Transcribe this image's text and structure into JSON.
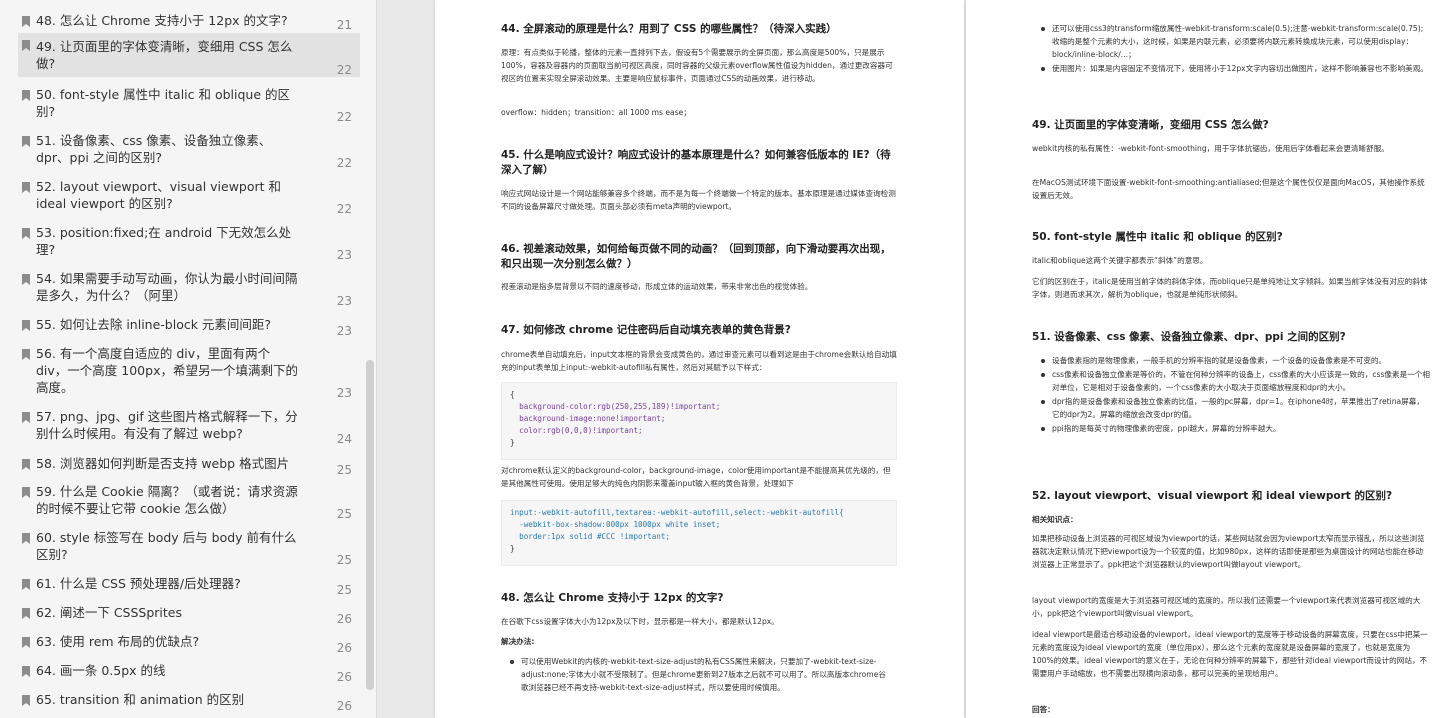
{
  "toc": [
    {
      "title": "48. 怎么让 Chrome 支持小于 12px 的文字?",
      "page": "21"
    },
    {
      "title": "49. 让页面里的字体变清晰，变细用 CSS 怎么做?",
      "page": "22"
    },
    {
      "title": "50. font-style 属性中 italic 和 oblique 的区别?",
      "page": "22"
    },
    {
      "title": "51. 设备像素、css 像素、设备独立像素、dpr、ppi 之间的区别?",
      "page": "22"
    },
    {
      "title": "52. layout viewport、visual viewport 和 ideal viewport 的区别?",
      "page": "22"
    },
    {
      "title": "53. position:fixed;在 android 下无效怎么处理?",
      "page": "23"
    },
    {
      "title": "54. 如果需要手动写动画，你认为最小时间间隔是多久，为什么？（阿里）",
      "page": "23"
    },
    {
      "title": "55. 如何让去除 inline-block 元素间间距?",
      "page": "23"
    },
    {
      "title": "56. 有一个高度自适应的 div，里面有两个 div，一个高度 100px，希望另一个填满剩下的高度。",
      "page": "23"
    },
    {
      "title": "57. png、jpg、gif 这些图片格式解释一下，分别什么时候用。有没有了解过 webp?",
      "page": "24"
    },
    {
      "title": "58. 浏览器如何判断是否支持 webp 格式图片",
      "page": "25"
    },
    {
      "title": "59. 什么是 Cookie 隔离？（或者说：请求资源的时候不要让它带 cookie 怎么做）",
      "page": "25"
    },
    {
      "title": "60. style 标签写在 body 后与 body 前有什么区别?",
      "page": "25"
    },
    {
      "title": "61. 什么是 CSS 预处理器/后处理器?",
      "page": "25"
    },
    {
      "title": "62. 阐述一下 CSSSprites",
      "page": "26"
    },
    {
      "title": "63. 使用 rem 布局的优缺点?",
      "page": "26"
    },
    {
      "title": "64. 画一条 0.5px 的线",
      "page": "26"
    },
    {
      "title": "65. transition 和 animation 的区别",
      "page": "26"
    }
  ],
  "page1": {
    "q44_title": "44. 全屏滚动的原理是什么？用到了 CSS 的哪些属性？（待深入实践）",
    "q44_body": "原理：有点类似于轮播，整体的元素一直排列下去，假设有5个需要展示的全屏页面，那么高度是500%，只是展示100%，容器及容器内的页面取当前可视区高度，同时容器的父级元素overflow属性值设为hidden，通过更改容器可视区的位置来实现全屏滚动效果。主要是响应鼠标事件，页面通过CSS的动画效果，进行移动。",
    "q44_code": "overflow：hidden；transition：all 1000 ms ease；",
    "q45_title": "45. 什么是响应式设计？响应式设计的基本原理是什么？如何兼容低版本的 IE?（待深入了解）",
    "q45_body": "响应式网站设计是一个网站能够兼容多个终端，而不是为每一个终端做一个特定的版本。基本原理是通过媒体查询检测不同的设备屏幕尺寸做处理。页面头部必须有meta声明的viewport。",
    "q46_title": "46. 视差滚动效果，如何给每页做不同的动画？（回到顶部，向下滑动要再次出现，和只出现一次分别怎么做？）",
    "q46_body": "视差滚动是指多层背景以不同的速度移动，形成立体的运动效果，带来非常出色的视觉体验。",
    "q47_title": "47. 如何修改 chrome 记住密码后自动填充表单的黄色背景?",
    "q47_body": "chrome表单自动填充后，input文本框的背景会变成黄色的，通过审查元素可以看到这是由于chrome会默认给自动填充的input表单加上input:-webkit-autofill私有属性，然后对其赋予以下样式：",
    "q47_code1": [
      "{",
      "  background-color:rgb(250,255,189)!important;",
      "  background-image:none!important;",
      "  color:rgb(0,0,0)!important;",
      "}"
    ],
    "q47_body2": "对chrome默认定义的background-color，background-image，color使用important是不能提高其优先级的，但是其他属性可使用。使用足够大的纯色内阴影来覆盖input输入框的黄色背景，处理如下",
    "q47_code2": [
      "input:-webkit-autofill,textarea:-webkit-autofill,select:-webkit-autofill{",
      "  -webkit-box-shadow:000px 1000px white inset;",
      "  border:1px solid #CCC !important;",
      "}"
    ],
    "q48_title": "48. 怎么让 Chrome 支持小于 12px 的文字?",
    "q48_body": "在谷歌下css设置字体大小为12px及以下时，显示都是一样大小，都是默认12px。",
    "q48_sol": "解决办法:",
    "q48_li1": "可以使用Webkit的内核的-webkit-text-size-adjust的私有CSS属性来解决，只要加了-webkit-text-size-adjust:none;字体大小就不受限制了。但是chrome更新到27版本之后就不可以用了。所以高版本chrome谷歌浏览器已经不再支持-webkit-text-size-adjust样式，所以要使用时候慎用。"
  },
  "page2": {
    "li_a": "还可以使用css3的transform缩放属性-webkit-transform:scale(0.5);注意-webkit-transform:scale(0.75);收缩的是整个元素的大小，这时候，如果是内联元素，必须要将内联元素转换成块元素，可以使用display：block/inline-block/...；",
    "li_b": "使用图片：如果是内容固定不变情况下，使用将小于12px文字内容切出做图片，这样不影响兼容也不影响美观。",
    "q49_title": "49. 让页面里的字体变清晰，变细用 CSS 怎么做?",
    "q49_p1": "webkit内核的私有属性：-webkit-font-smoothing，用于字体抗锯齿，使用后字体看起来会更清晰舒服。",
    "q49_p2": "在MacOS测试环境下面设置-webkit-font-smoothing:antialiased;但是这个属性仅仅是面向MacOS，其他操作系统设置后无效。",
    "q50_title": "50. font-style 属性中 italic 和 oblique 的区别?",
    "q50_p1": "italic和oblique这两个关键字都表示“斜体”的意思。",
    "q50_p2": "它们的区别在于，italic是使用当前字体的斜体字体，而oblique只是单纯地让文字倾斜。如果当前字体没有对应的斜体字体，则退而求其次，解析为oblique，也就是单纯形状倾斜。",
    "q51_title": "51. 设备像素、css 像素、设备独立像素、dpr、ppi 之间的区别?",
    "q51_li1": "设备像素指的是物理像素，一般手机的分辨率指的就是设备像素，一个设备的设备像素是不可变的。",
    "q51_li2": "css像素和设备独立像素是等价的，不管在何种分辨率的设备上，css像素的大小应该是一致的，css像素是一个相对单位，它是相对于设备像素的，一个css像素的大小取决于页面缩放程度和dpr的大小。",
    "q51_li3": "dpr指的是设备像素和设备独立像素的比值，一般的pc屏幕，dpr=1。在iphone4时，苹果推出了retina屏幕，它的dpr为2。屏幕的缩放会改变dpr的值。",
    "q51_li4": "ppi指的是每英寸的物理像素的密度，ppi越大，屏幕的分辨率越大。",
    "q52_title": "52. layout viewport、visual viewport 和 ideal viewport 的区别?",
    "q52_sub": "相关知识点：",
    "q52_p1": "如果把移动设备上浏览器的可视区域设为viewport的话，某些网站就会因为viewport太窄而显示错乱，所以这些浏览器就决定默认情况下把viewport设为一个较宽的值，比如980px，这样的话即使是那些为桌面设计的网站也能在移动浏览器上正常显示了。ppk把这个浏览器默认的viewport叫做layout viewport。",
    "q52_p2": "layout viewport的宽度是大于浏览器可视区域的宽度的，所以我们还需要一个viewport来代表浏览器可视区域的大小，ppk把这个viewport叫做visual viewport。",
    "q52_p3": "ideal viewport是最适合移动设备的viewport，ideal viewport的宽度等于移动设备的屏幕宽度，只要在css中把某一元素的宽度设为ideal viewport的宽度（单位用px），那么这个元素的宽度就是设备屏幕的宽度了，也就是宽度为100%的效果。ideal viewport的意义在于，无论在何种分辨率的屏幕下，那些针对ideal viewport而设计的网站，不需要用户手动缩放，也不需要出现横向滚动条，都可以完美的呈现给用户。",
    "q52_ans": "回答："
  }
}
